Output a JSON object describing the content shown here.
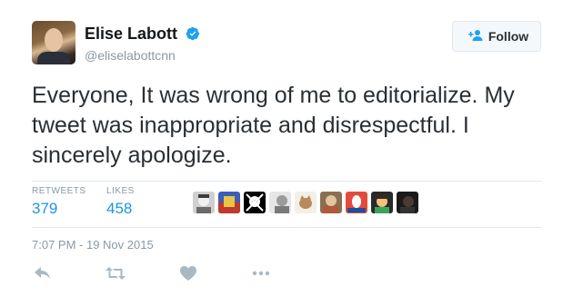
{
  "author": {
    "name": "Elise Labott",
    "handle": "@eliselabottcnn",
    "verified": true,
    "avatar_icon": "profile-photo"
  },
  "follow_button": {
    "label": "Follow",
    "icon": "add-user-icon"
  },
  "tweet": {
    "text": "Everyone, It was wrong of me to editorialize. My tweet was inappropriate and disrespectful. I sincerely apologize."
  },
  "stats": {
    "retweets_label": "RETWEETS",
    "retweets_value": "379",
    "likes_label": "LIKES",
    "likes_value": "458"
  },
  "likers": [
    {
      "icon": "liker-avatar-1"
    },
    {
      "icon": "liker-avatar-2"
    },
    {
      "icon": "liker-avatar-3"
    },
    {
      "icon": "liker-avatar-4"
    },
    {
      "icon": "liker-avatar-5"
    },
    {
      "icon": "liker-avatar-6"
    },
    {
      "icon": "liker-avatar-7"
    },
    {
      "icon": "liker-avatar-8"
    },
    {
      "icon": "liker-avatar-9"
    }
  ],
  "timestamp": "7:07 PM - 19 Nov 2015",
  "actions": [
    {
      "name": "reply",
      "icon": "reply-icon"
    },
    {
      "name": "retweet",
      "icon": "retweet-icon"
    },
    {
      "name": "like",
      "icon": "heart-icon"
    },
    {
      "name": "more",
      "icon": "more-icon"
    }
  ],
  "colors": {
    "link_blue": "#1b95e0",
    "muted_gray": "#8899a6",
    "text": "#292f33",
    "verified_blue": "#1da1f2",
    "divider": "#e1e8ed",
    "action_gray": "#aab8c2"
  }
}
